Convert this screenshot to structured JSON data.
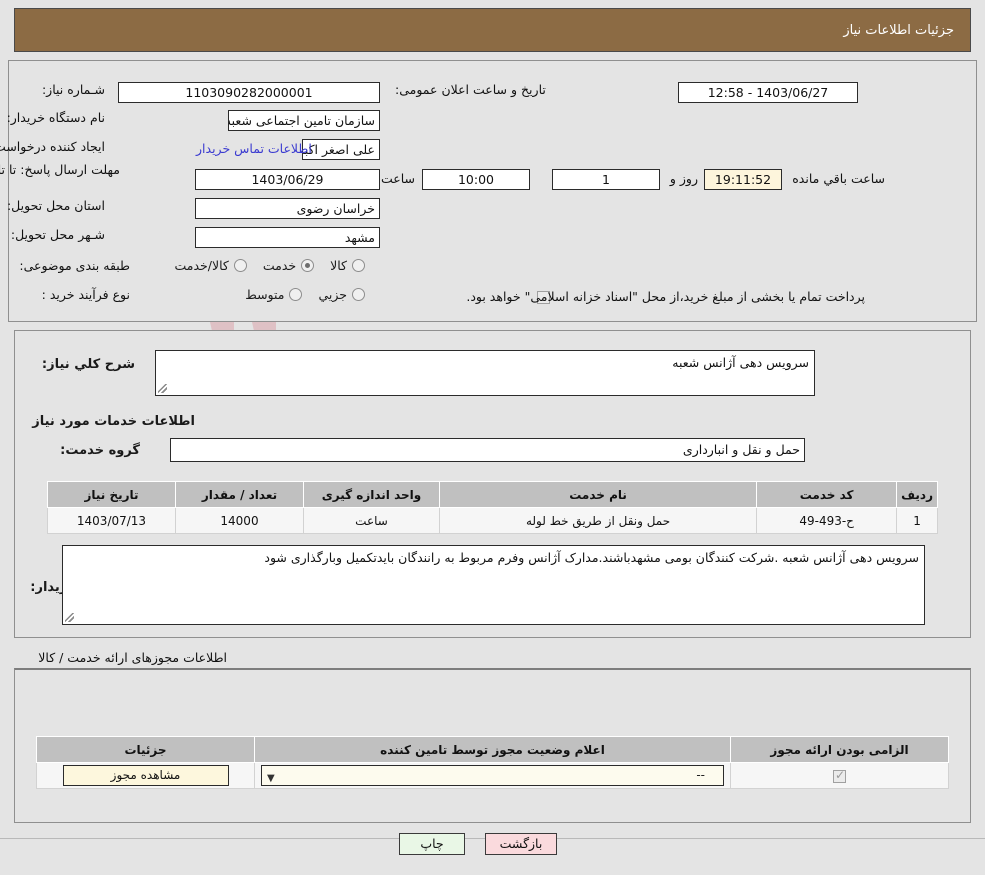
{
  "header": {
    "title": "جزئیات اطلاعات نیاز",
    "bg": "#8c6b44"
  },
  "watermark": {
    "text": "AnaTender.net"
  },
  "top": {
    "need_number_label": "شـماره نیاز:",
    "need_number_value": "1103090282000001",
    "announce_label": "تاریخ و ساعت اعلان عمومی:",
    "announce_value": "1403/06/27 - 12:58",
    "buyer_org_label": "نام دستگاه خریدار:",
    "buyer_org_value": "سازمان تامین اجتماعی شعبه چهار مشهد",
    "creator_label": "ایجاد کننده درخواست:",
    "creator_value": "علی اصغر اکبری اره کمر کاربرداز سازمان تامین اجتماعی شعبه چهار مشهد",
    "contact_link": "اطلاعات تماس خریدار",
    "deadline_label": "مهلت ارسال پاسخ: تا تاریخ:",
    "deadline_date": "1403/06/29",
    "deadline_hour_label": "ساعت",
    "deadline_hour": "10:00",
    "days_value": "1",
    "days_label": "روز و",
    "countdown": "19:11:52",
    "countdown_label": "ساعت باقي مانده",
    "province_label": "استان محل تحویل:",
    "province_value": "خراسان رضوی",
    "city_label": "شـهر محل تحویل:",
    "city_value": "مشهد",
    "classification_label": "طبقه بندی موضوعی:",
    "classification_options": [
      {
        "label": "کالا",
        "selected": false
      },
      {
        "label": "خدمت",
        "selected": true
      },
      {
        "label": "کالا/خدمت",
        "selected": false
      }
    ],
    "process_label": "نوع فرآیند خرید :",
    "process_options": [
      {
        "label": "جزیي",
        "selected": false
      },
      {
        "label": "متوسط",
        "selected": false
      }
    ],
    "treasury_checkbox_checked": false,
    "treasury_note": "پرداخت تمام یا بخشی از مبلغ خرید،از محل \"اسناد خزانه اسلامی\" خواهد بود."
  },
  "mid": {
    "summary_label": "شرح کلي نیاز:",
    "summary_value": "سرویس دهی آژانس شعبه",
    "services_section_title": "اطلاعات خدمات مورد نیاز",
    "service_group_label": "گروه خدمت:",
    "service_group_value": "حمل و نقل و انبارداری",
    "table": {
      "columns": [
        "ردیف",
        "کد خدمت",
        "نام خدمت",
        "واحد اندازه گیری",
        "تعداد / مقدار",
        "تاریخ نیاز"
      ],
      "rows": [
        [
          "1",
          "ح-493-49",
          "حمل ونقل از طریق خط لوله",
          "ساعت",
          "14000",
          "1403/07/13"
        ]
      ]
    },
    "buyer_notes_label": "توضیحات خریدار:",
    "buyer_notes_value": "سرویس دهی آژانس شعبه .شرکت کنندگان بومی مشهدباشند.مدارک آژانس وفرم مربوط به رانندگان بایدتکمیل وبارگذاری شود"
  },
  "permits": {
    "section_title": "اطلاعات مجوزهای ارائه خدمت / کالا",
    "table": {
      "columns": [
        "الزامی بودن ارائه مجوز",
        "اعلام وضعیت مجوز توسط تامین کننده",
        "جزئیات"
      ],
      "rows": [
        {
          "required_checked": true,
          "status_value": "--",
          "details_button": "مشاهده مجوز"
        }
      ]
    }
  },
  "footer": {
    "print_label": "چاپ",
    "back_label": "بازگشت"
  }
}
